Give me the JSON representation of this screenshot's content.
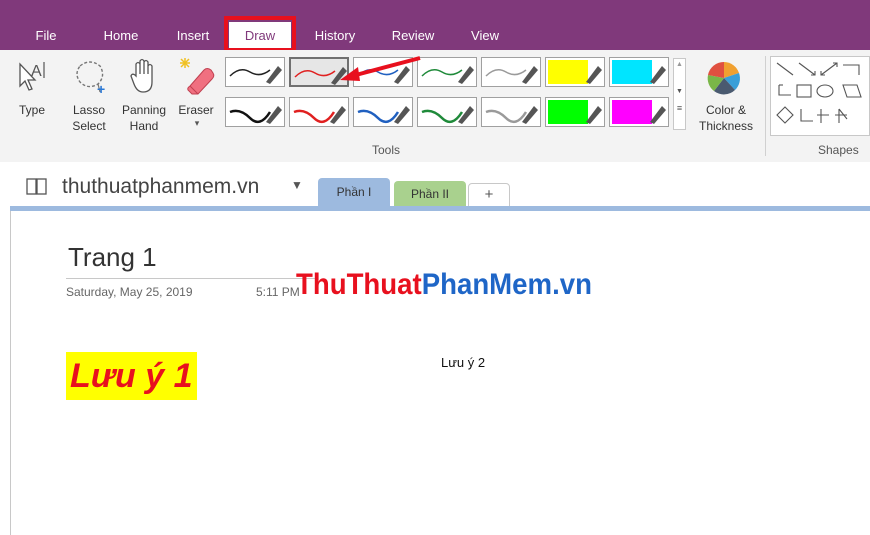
{
  "ribbon_tabs": {
    "file": "File",
    "home": "Home",
    "insert": "Insert",
    "draw": "Draw",
    "history": "History",
    "review": "Review",
    "view": "View"
  },
  "draw_group": {
    "type_label": "Type",
    "lasso_label_1": "Lasso",
    "lasso_label_2": "Select",
    "panning_label_1": "Panning",
    "panning_label_2": "Hand",
    "eraser_label": "Eraser",
    "tools_group_label": "Tools",
    "color_label_1": "Color &",
    "color_label_2": "Thickness",
    "shapes_group_label": "Shapes"
  },
  "pens": {
    "row1": [
      "#222222",
      "#e02020",
      "#2060c0",
      "#1f8a3a",
      "#9a9a9a",
      "#ffff00",
      "#00e5ff"
    ],
    "row2": [
      "#111111",
      "#e02020",
      "#2060c0",
      "#1f8a3a",
      "#9a9a9a",
      "#00ff00",
      "#ff00ff"
    ]
  },
  "notebook": {
    "name": "thuthuatphanmem.vn",
    "sections": [
      "Phần I",
      "Phần II"
    ],
    "add_tab": "+"
  },
  "page": {
    "title": "Trang 1",
    "date": "Saturday, May 25, 2019",
    "time": "5:11 PM",
    "watermark_part1": "ThuThuat",
    "watermark_part2": "PhanMem.vn",
    "note1": "Lưu ý 1",
    "note2": "Lưu ý 2"
  },
  "colors": {
    "ribbon_purple": "#80397b",
    "highlight_red": "#e8101e",
    "section1_blue": "#9dbadf",
    "section2_green": "#a9d18e"
  }
}
